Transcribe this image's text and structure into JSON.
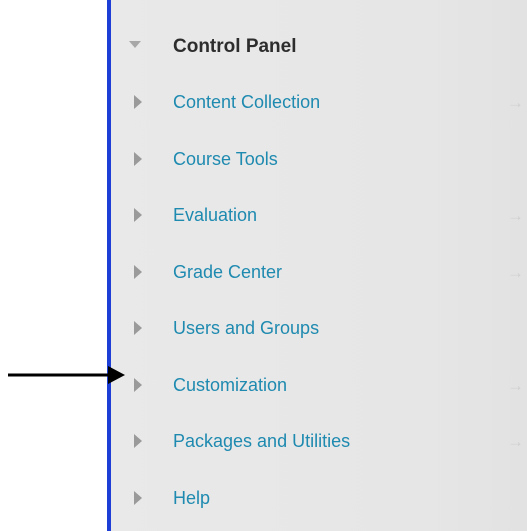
{
  "control_panel": {
    "title": "Control Panel",
    "items": [
      {
        "label": "Content Collection",
        "has_arrow": true
      },
      {
        "label": "Course Tools",
        "has_arrow": false
      },
      {
        "label": "Evaluation",
        "has_arrow": true
      },
      {
        "label": "Grade Center",
        "has_arrow": true
      },
      {
        "label": "Users and Groups",
        "has_arrow": false
      },
      {
        "label": "Customization",
        "has_arrow": true
      },
      {
        "label": "Packages and Utilities",
        "has_arrow": true
      },
      {
        "label": "Help",
        "has_arrow": false
      }
    ],
    "arrow_glyph": "→"
  },
  "annotation": {
    "pointer_target": "Customization",
    "icon": "pointer-arrow-icon"
  },
  "colors": {
    "panel_edge": "#1d3fd6",
    "link": "#1e8ab0",
    "header_text": "#2d2d2d"
  }
}
